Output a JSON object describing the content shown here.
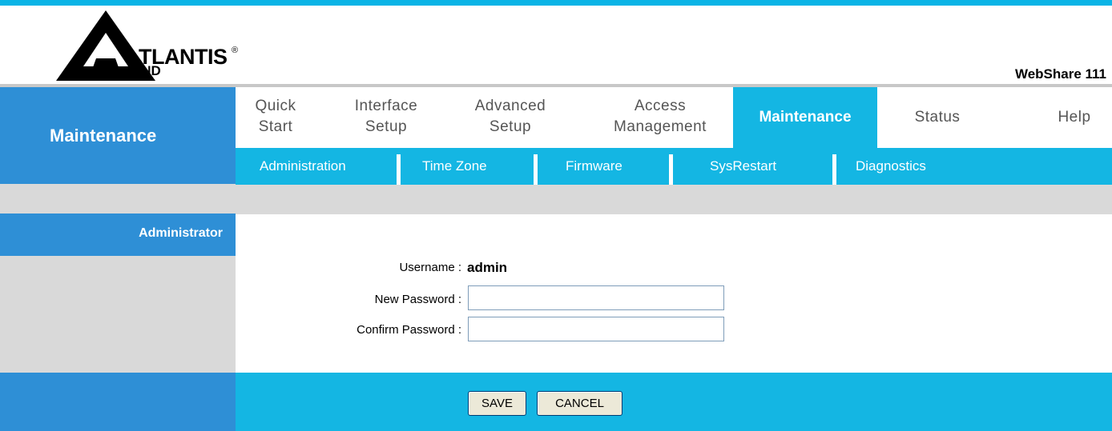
{
  "brand": {
    "logo_word": "TLANTIS",
    "logo_sub": "AND",
    "registered_mark": "®",
    "product_name": "WebShare 111"
  },
  "sidebar": {
    "section_title": "Maintenance",
    "subsection_title": "Administrator"
  },
  "nav": {
    "tabs": [
      {
        "line1": "Quick",
        "line2": "Start"
      },
      {
        "line1": "Interface",
        "line2": "Setup"
      },
      {
        "line1": "Advanced",
        "line2": "Setup"
      },
      {
        "line1": "Access",
        "line2": "Management"
      },
      {
        "line1": "Maintenance",
        "line2": ""
      },
      {
        "line1": "Status",
        "line2": ""
      },
      {
        "line1": "Help",
        "line2": ""
      }
    ],
    "active_tab": "Maintenance"
  },
  "subnav": {
    "items": [
      "Administration",
      "Time Zone",
      "Firmware",
      "SysRestart",
      "Diagnostics"
    ],
    "active_item": "Administration"
  },
  "form": {
    "username_label": "Username :",
    "username_value": "admin",
    "new_password_label": "New Password :",
    "new_password_value": "",
    "confirm_password_label": "Confirm Password :",
    "confirm_password_value": ""
  },
  "actions": {
    "save_label": "SAVE",
    "cancel_label": "CANCEL"
  },
  "colors": {
    "accent_cyan": "#14b6e3",
    "accent_blue": "#2e8fd6",
    "panel_gray": "#d9d9d9"
  }
}
